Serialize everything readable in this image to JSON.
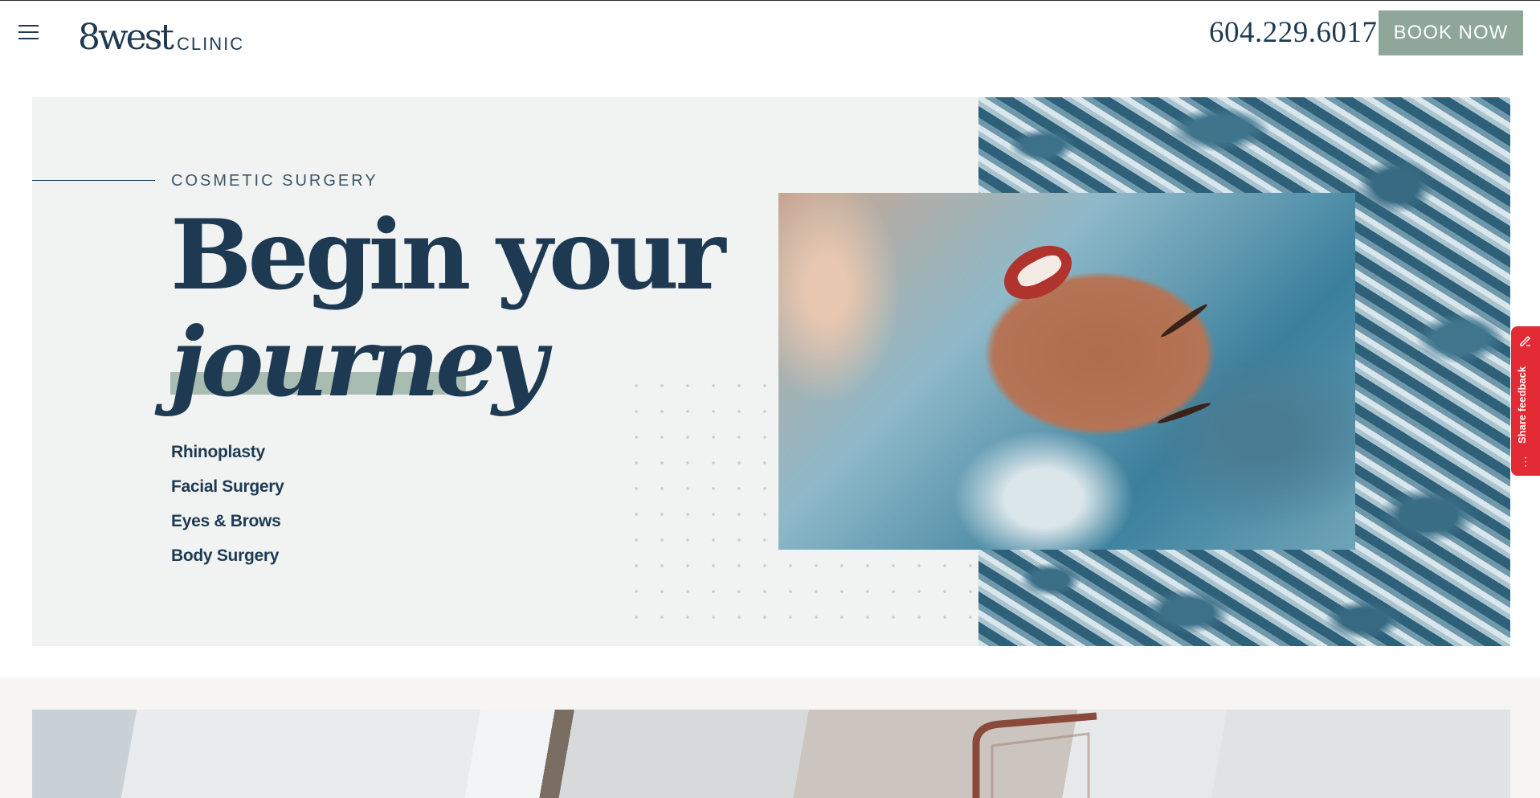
{
  "header": {
    "logo_mark": "8west",
    "logo_sub": "CLINIC",
    "phone": "604.229.6017",
    "book_label": "BOOK NOW"
  },
  "hero": {
    "eyebrow": "COSMETIC SURGERY",
    "headline_line1": "Begin your",
    "headline_line2": "journey",
    "services": [
      "Rhinoplasty",
      "Facial Surgery",
      "Eyes & Brows",
      "Body Surgery"
    ]
  },
  "feedback": {
    "label": "Share feedback",
    "more": "⋮"
  },
  "colors": {
    "navy": "#1e3a52",
    "sage": "#8fa799",
    "highlight": "#a8bcb1",
    "hero_bg": "#f1f3f3",
    "feedback_red": "#e32b35"
  }
}
